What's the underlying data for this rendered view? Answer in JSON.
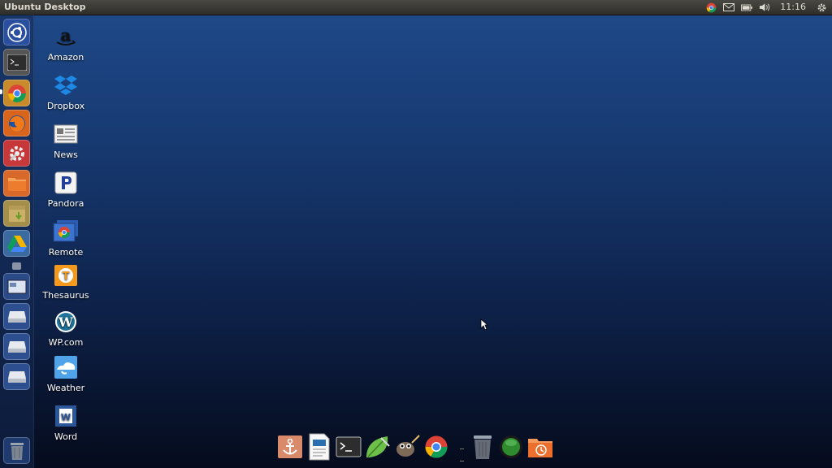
{
  "top_panel": {
    "title": "Ubuntu Desktop",
    "clock": "11:16"
  },
  "desktop_icons": [
    {
      "label": "Amazon"
    },
    {
      "label": "Dropbox"
    },
    {
      "label": "News"
    },
    {
      "label": "Pandora"
    },
    {
      "label": "Remote"
    },
    {
      "label": "Thesaurus"
    },
    {
      "label": "WP.com"
    },
    {
      "label": "Weather"
    },
    {
      "label": "Word"
    }
  ],
  "colors": {
    "ubuntu_orange": "#e95420",
    "desktop_top": "#1f4a8a",
    "desktop_bottom": "#050b1c"
  }
}
